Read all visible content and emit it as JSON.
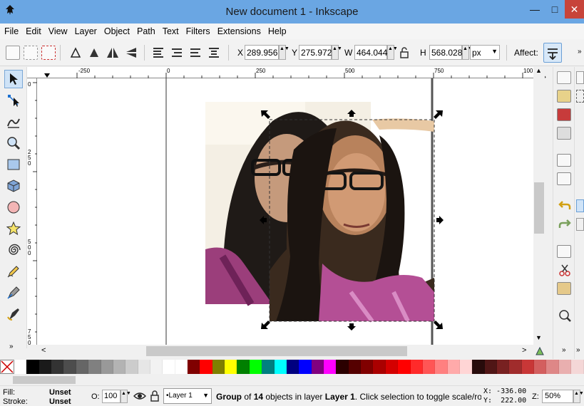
{
  "window": {
    "title": "New document 1 - Inkscape",
    "minimize": "—",
    "maximize": "□",
    "close": "✕"
  },
  "menu": [
    "File",
    "Edit",
    "View",
    "Layer",
    "Object",
    "Path",
    "Text",
    "Filters",
    "Extensions",
    "Help"
  ],
  "toolbar": {
    "x_label": "X",
    "x_value": "289.956",
    "y_label": "Y",
    "y_value": "275.972",
    "w_label": "W",
    "w_value": "464.044",
    "h_label": "H",
    "h_value": "568.028",
    "unit": "px",
    "affect_label": "Affect:"
  },
  "ruler": {
    "h_ticks": [
      "-250",
      "0",
      "250",
      "500",
      "750",
      "100"
    ],
    "v_ticks": [
      "0",
      "2 5 0",
      "5 0 0",
      "7 5 0"
    ]
  },
  "palette": [
    "#ffffff",
    "#000000",
    "#1a1a1a",
    "#333333",
    "#4d4d4d",
    "#666666",
    "#808080",
    "#999999",
    "#b3b3b3",
    "#cccccc",
    "#e6e6e6",
    "#f2f2f2",
    "#ffffff",
    "#ffffff",
    "#800000",
    "#ff0000",
    "#808000",
    "#ffff00",
    "#008000",
    "#00ff00",
    "#008080",
    "#00ffff",
    "#000080",
    "#0000ff",
    "#800080",
    "#ff00ff",
    "#2b0000",
    "#550000",
    "#800000",
    "#aa0000",
    "#d40000",
    "#ff0000",
    "#ff2a2a",
    "#ff5555",
    "#ff8080",
    "#ffaaaa",
    "#ffd5d5",
    "#280b0b",
    "#501616",
    "#782121",
    "#a02c2c",
    "#c83737",
    "#d35f5f",
    "#de8787",
    "#e9afaf",
    "#f4d7d7"
  ],
  "status": {
    "fill_label": "Fill:",
    "fill_value": "Unset",
    "stroke_label": "Stroke:",
    "stroke_value": "Unset",
    "opacity_label": "O:",
    "opacity_value": "100",
    "layer_value": "•Layer 1",
    "msg_a": "Group",
    "msg_b": " of ",
    "msg_c": "14",
    "msg_d": " objects in layer ",
    "msg_e": "Layer 1",
    "msg_f": ". Click selection to toggle scale/rot",
    "cursor_x": "X: -336.00",
    "cursor_y": "Y:  222.00",
    "zoom_label": "Z:",
    "zoom_value": "50%"
  }
}
